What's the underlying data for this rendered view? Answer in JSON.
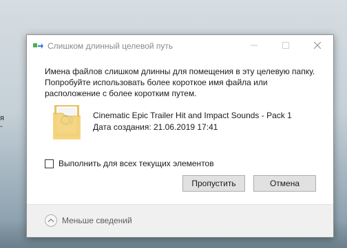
{
  "background": {
    "left_text": [
      "я",
      "-"
    ]
  },
  "dialog": {
    "title": "Слишком длинный целевой путь",
    "message_lines": [
      "Имена файлов слишком длинны для помещения в эту целевую папку.",
      "Попробуйте использовать более короткое имя файла или",
      "расположение с более коротким путем."
    ],
    "file": {
      "name": "Cinematic Epic Trailer Hit and Impact Sounds - Pack 1",
      "date": "Дата создания: 21.06.2019 17:41",
      "icon": "folder-with-media-icon"
    },
    "apply_all_label": "Выполнить для всех текущих элементов",
    "apply_all_checked": false,
    "buttons": {
      "skip": "Пропустить",
      "cancel": "Отмена"
    },
    "footer": {
      "less_details": "Меньше сведений"
    }
  },
  "colors": {
    "title_text": "#8a8a8a",
    "button_bg": "#e1e1e1",
    "footer_bg": "#f0f0f0"
  }
}
